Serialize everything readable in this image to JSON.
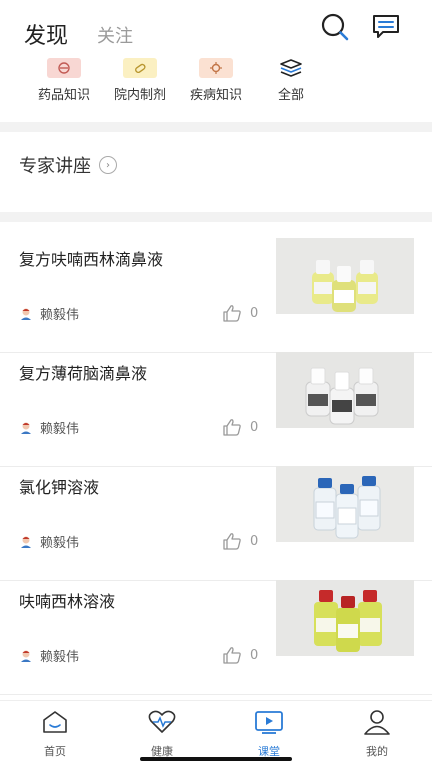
{
  "header": {
    "tab_discover": "发现",
    "tab_follow": "关注"
  },
  "categories": [
    {
      "label": "药品知识",
      "icon": "pill-icon",
      "color": "#f8d7d3"
    },
    {
      "label": "院内制剂",
      "icon": "capsule-icon",
      "color": "#fbf0c2"
    },
    {
      "label": "疾病知识",
      "icon": "virus-icon",
      "color": "#fbe1d2"
    },
    {
      "label": "全部",
      "icon": "layers-icon",
      "color": "#ffffff"
    }
  ],
  "expert": {
    "label": "专家讲座"
  },
  "articles": [
    {
      "title": "复方呋喃西林滴鼻液",
      "author": "赖毅伟",
      "likes": "0",
      "bottle_color": "#e9ea8a",
      "cap_color": "#f4f4f4"
    },
    {
      "title": "复方薄荷脑滴鼻液",
      "author": "赖毅伟",
      "likes": "0",
      "bottle_color": "#f3f3f3",
      "cap_color": "#f4f4f4"
    },
    {
      "title": "氯化钾溶液",
      "author": "赖毅伟",
      "likes": "0",
      "bottle_color": "#eef3f7",
      "cap_color": "#2b66b8"
    },
    {
      "title": "呋喃西林溶液",
      "author": "赖毅伟",
      "likes": "0",
      "bottle_color": "#d7e05a",
      "cap_color": "#c52a2a"
    }
  ],
  "tabbar": [
    {
      "label": "首页",
      "icon": "home-face-icon",
      "active": false
    },
    {
      "label": "健康",
      "icon": "heart-pulse-icon",
      "active": false
    },
    {
      "label": "课堂",
      "icon": "video-play-icon",
      "active": true
    },
    {
      "label": "我的",
      "icon": "user-icon",
      "active": false
    }
  ],
  "accent_color": "#2a7bd6"
}
